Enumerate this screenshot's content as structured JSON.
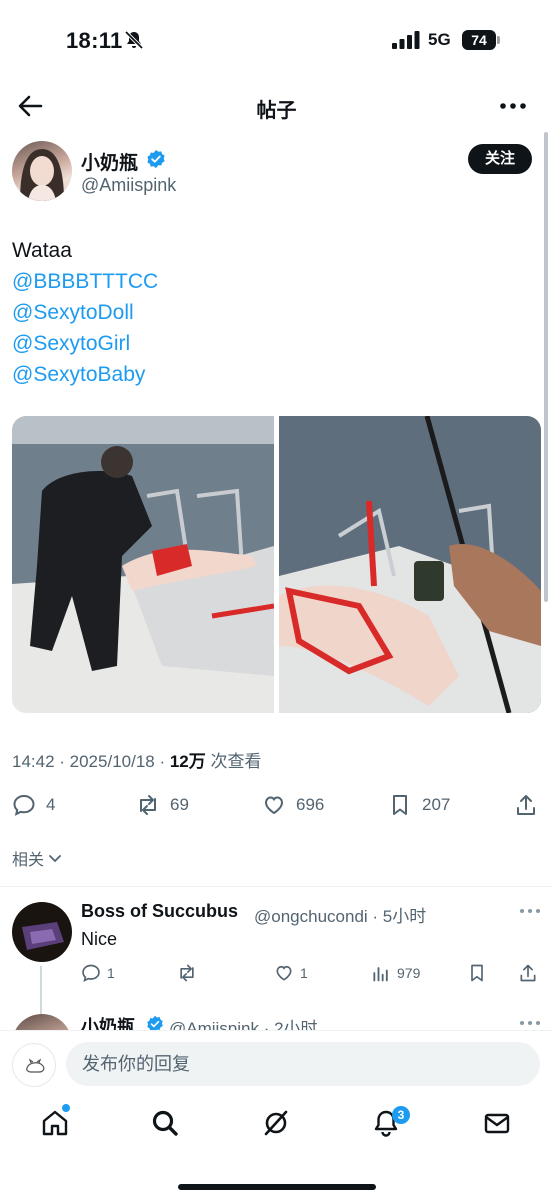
{
  "status_bar": {
    "time": "18:11",
    "network": "5G",
    "battery": "74"
  },
  "nav": {
    "title": "帖子"
  },
  "author": {
    "name": "小奶瓶",
    "handle": "@Amiispink",
    "follow_label": "关注"
  },
  "tweet": {
    "text": "Wataa",
    "mentions": [
      "@BBBBTTTCC",
      "@SexytoDoll",
      "@SexytoGirl",
      "@SexytoBaby"
    ],
    "timestamp": "14:42 · 2025/10/18 · ",
    "views_count": "12万",
    "views_label": " 次查看"
  },
  "actions": {
    "replies": "4",
    "retweets": "69",
    "likes": "696",
    "bookmarks": "207"
  },
  "related_label": "相关",
  "reply1": {
    "name": "Boss of Succubus",
    "handle_time": "@ongchucondi · 5小时",
    "text": "Nice",
    "replies": "1",
    "likes": "1",
    "views": "979"
  },
  "reply2": {
    "name": "小奶瓶",
    "handle_time": "@Amiispink · 2小时"
  },
  "compose": {
    "placeholder": "发布你的回复"
  },
  "tabbar": {
    "notification_count": "3"
  },
  "colors": {
    "accent": "#1d9bf0",
    "text": "#0f1419",
    "secondary": "#536471"
  }
}
